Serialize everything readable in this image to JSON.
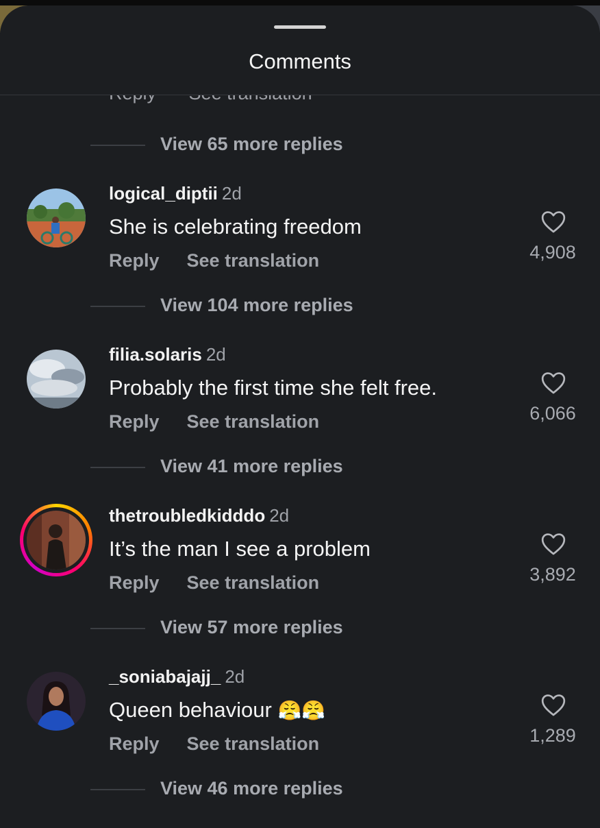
{
  "header": {
    "title": "Comments"
  },
  "clipped_actions": {
    "reply": "Reply",
    "translate": "See translation"
  },
  "top_replies": {
    "label": "View 65 more replies"
  },
  "comments": [
    {
      "username": "logical_diptii",
      "time": "2d",
      "text": "She is celebrating freedom",
      "reply": "Reply",
      "translate": "See translation",
      "likes": "4,908",
      "replies": "View 104 more replies",
      "avatar": "photo-woman-on-bicycle"
    },
    {
      "username": "filia.solaris",
      "time": "2d",
      "text": "Probably the first time she felt free.",
      "reply": "Reply",
      "translate": "See translation",
      "likes": "6,066",
      "replies": "View 41 more replies",
      "avatar": "photo-cloudy-sky"
    },
    {
      "username": "thetroubledkidddo",
      "time": "2d",
      "text": "It’s the man I see a problem",
      "reply": "Reply",
      "translate": "See translation",
      "likes": "3,892",
      "replies": "View 57 more replies",
      "avatar": "photo-person-portrait",
      "has_story": true
    },
    {
      "username": "_soniabajajj_",
      "time": "2d",
      "text": "Queen behaviour",
      "emoji": "😤😤",
      "reply": "Reply",
      "translate": "See translation",
      "likes": "1,289",
      "replies": "View 46 more replies",
      "avatar": "photo-woman-blue-dress"
    }
  ],
  "icons": {
    "like": "heart-icon"
  }
}
